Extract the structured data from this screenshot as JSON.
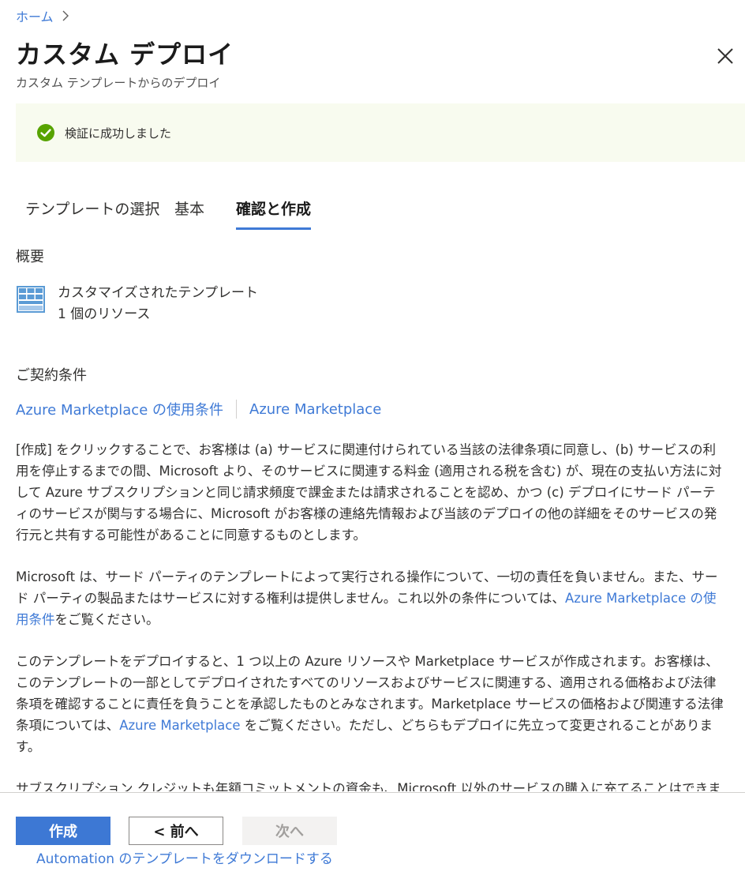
{
  "breadcrumb": {
    "home": "ホーム"
  },
  "header": {
    "title": "カスタム デプロイ",
    "subtitle": "カスタム テンプレートからのデプロイ"
  },
  "banner": {
    "message": "検証に成功しました",
    "status_color": "#57a300"
  },
  "tabs": [
    {
      "label": "テンプレートの選択",
      "active": false
    },
    {
      "label": "基本",
      "active": false
    },
    {
      "label": "確認と作成",
      "active": true
    }
  ],
  "summary": {
    "heading": "概要",
    "template_name": "カスタマイズされたテンプレート",
    "resource_count": "1 個のリソース"
  },
  "terms": {
    "heading": "ご契約条件",
    "link_terms": "Azure Marketplace の使用条件",
    "link_marketplace": "Azure Marketplace",
    "p1": "[作成] をクリックすることで、お客様は (a) サービスに関連付けられている当該の法律条項に同意し、(b) サービスの利用を停止するまでの間、Microsoft より、そのサービスに関連する料金 (適用される税を含む) が、現在の支払い方法に対して Azure サブスクリプションと同じ請求頻度で課金または請求されることを認め、かつ (c) デプロイにサード パーティのサービスが関与する場合に、Microsoft がお客様の連絡先情報および当該のデプロイの他の詳細をそのサービスの発行元と共有する可能性があることに同意するものとします。",
    "p2_before": "Microsoft は、サード パーティのテンプレートによって実行される操作について、一切の責任を負いません。また、サード パーティの製品またはサービスに対する権利は提供しません。これ以外の条件については、",
    "p2_link": "Azure Marketplace の使用条件",
    "p2_after": "をご覧ください。",
    "p3_before": "このテンプレートをデプロイすると、1 つ以上の Azure リソースや Marketplace サービスが作成されます。お客様は、このテンプレートの一部としてデプロイされたすべてのリソースおよびサービスに関連する、適用される価格および法律条項を確認することに責任を負うことを承認したものとみなされます。Marketplace サービスの価格および関連する法律条項については、",
    "p3_link": "Azure Marketplace",
    "p3_after": " をご覧ください。ただし、どちらもデプロイに先立って変更されることがあります。",
    "p4": "サブスクリプション クレジットも年額コミットメントの資金も、Microsoft 以外のサービスの購入に充てることはできません。これらの購入については別途請求されます。"
  },
  "footer": {
    "create_label": "作成",
    "prev_label": "< 前へ",
    "next_label": "次へ",
    "download_link": "Automation のテンプレートをダウンロードする"
  },
  "colors": {
    "accent": "#3f7ad6",
    "primary_button": "#3d78d4",
    "banner_bg": "#f8fbef"
  }
}
